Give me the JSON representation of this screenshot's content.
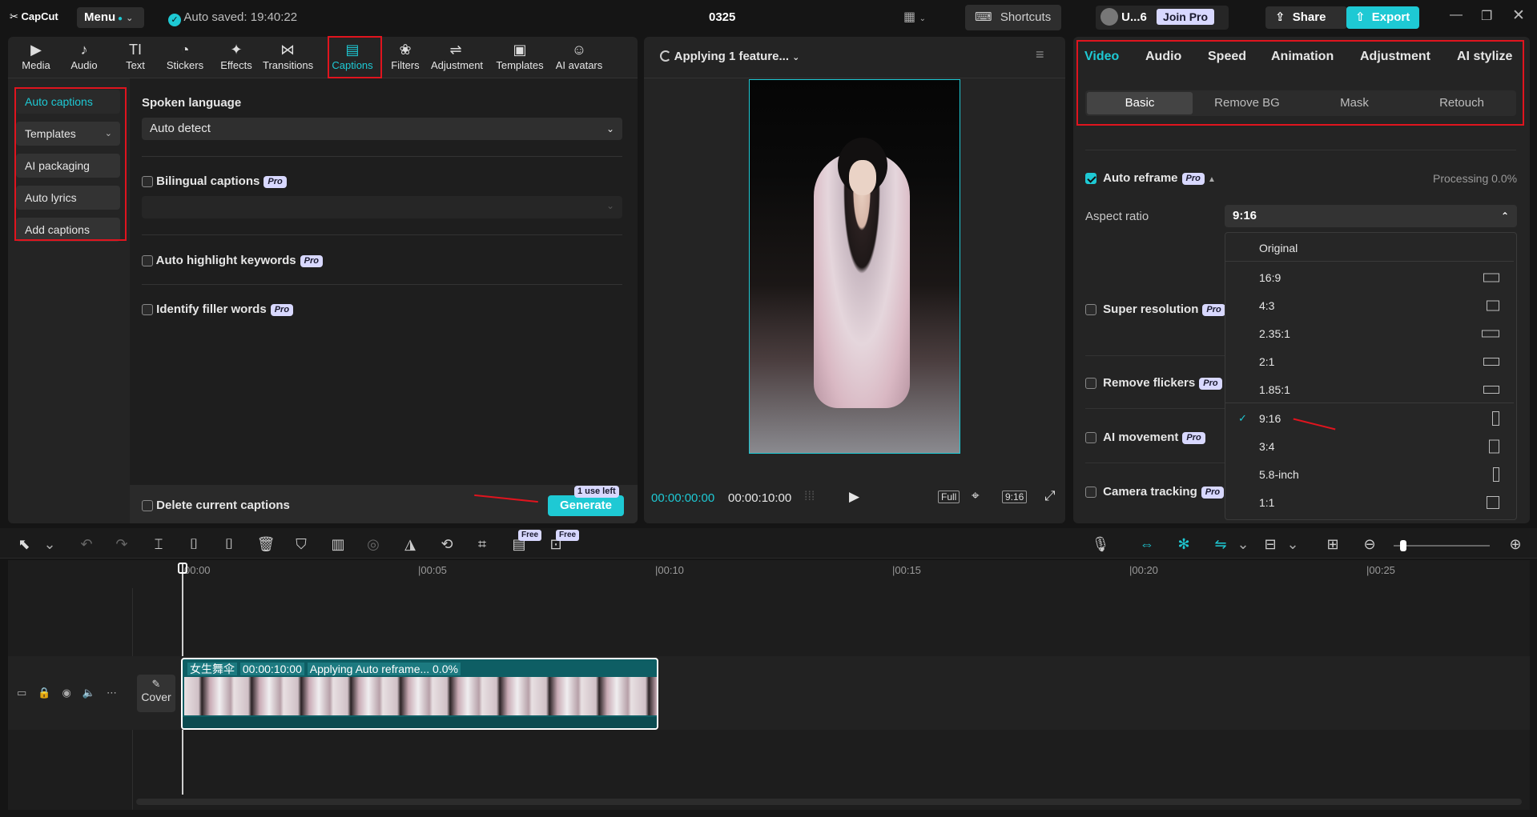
{
  "topbar": {
    "logo": "CapCut",
    "menu": "Menu",
    "autosave": "Auto saved: 19:40:22",
    "project": "0325",
    "shortcuts": "Shortcuts",
    "user": "U...6",
    "join_pro": "Join Pro",
    "share": "Share",
    "export": "Export"
  },
  "tools": [
    {
      "label": "Media",
      "icon": "▶"
    },
    {
      "label": "Audio",
      "icon": "♪"
    },
    {
      "label": "Text",
      "icon": "TI"
    },
    {
      "label": "Stickers",
      "icon": "◔"
    },
    {
      "label": "Effects",
      "icon": "✦"
    },
    {
      "label": "Transitions",
      "icon": "⋈"
    },
    {
      "label": "Captions",
      "icon": "▤"
    },
    {
      "label": "Filters",
      "icon": "❀"
    },
    {
      "label": "Adjustment",
      "icon": "⇌"
    },
    {
      "label": "Templates",
      "icon": "▣"
    },
    {
      "label": "AI avatars",
      "icon": "☺"
    }
  ],
  "sidebar": {
    "items": [
      {
        "label": "Auto captions"
      },
      {
        "label": "Templates"
      },
      {
        "label": "AI packaging"
      },
      {
        "label": "Auto lyrics"
      },
      {
        "label": "Add captions"
      }
    ]
  },
  "captions": {
    "spoken_language_label": "Spoken language",
    "spoken_language_value": "Auto detect",
    "bilingual": "Bilingual captions",
    "highlight": "Auto highlight keywords",
    "filler": "Identify filler words",
    "pro": "Pro",
    "delete_current": "Delete current captions",
    "generate": "Generate",
    "use_left": "1 use left"
  },
  "player": {
    "status": "Applying 1 feature...",
    "time_current": "00:00:00:00",
    "time_total": "00:00:10:00",
    "full": "Full",
    "ratio": "9:16"
  },
  "right": {
    "tabs": [
      "Video",
      "Audio",
      "Speed",
      "Animation",
      "Adjustment",
      "AI stylize"
    ],
    "subtabs": [
      "Basic",
      "Remove BG",
      "Mask",
      "Retouch"
    ],
    "auto_reframe": "Auto reframe",
    "processing": "Processing 0.0%",
    "aspect_ratio_label": "Aspect ratio",
    "aspect_ratio_value": "9:16",
    "super_resolution": "Super resolution",
    "remove_flickers": "Remove flickers",
    "ai_movement": "AI movement",
    "camera_tracking": "Camera tracking",
    "ratio_options": [
      "Original",
      "16:9",
      "4:3",
      "2.35:1",
      "2:1",
      "1.85:1",
      "9:16",
      "3:4",
      "5.8-inch",
      "1:1"
    ]
  },
  "timeline": {
    "ticks": [
      "00:00",
      "|00:05",
      "|00:10",
      "|00:15",
      "|00:20",
      "|00:25"
    ],
    "cover": "Cover",
    "clip_name": "女生舞伞",
    "clip_duration": "00:00:10:00",
    "clip_status": "Applying Auto reframe... 0.0%",
    "free": "Free"
  },
  "colors": {
    "accent": "#1ec9d4",
    "highlight_box": "#e0141e"
  }
}
